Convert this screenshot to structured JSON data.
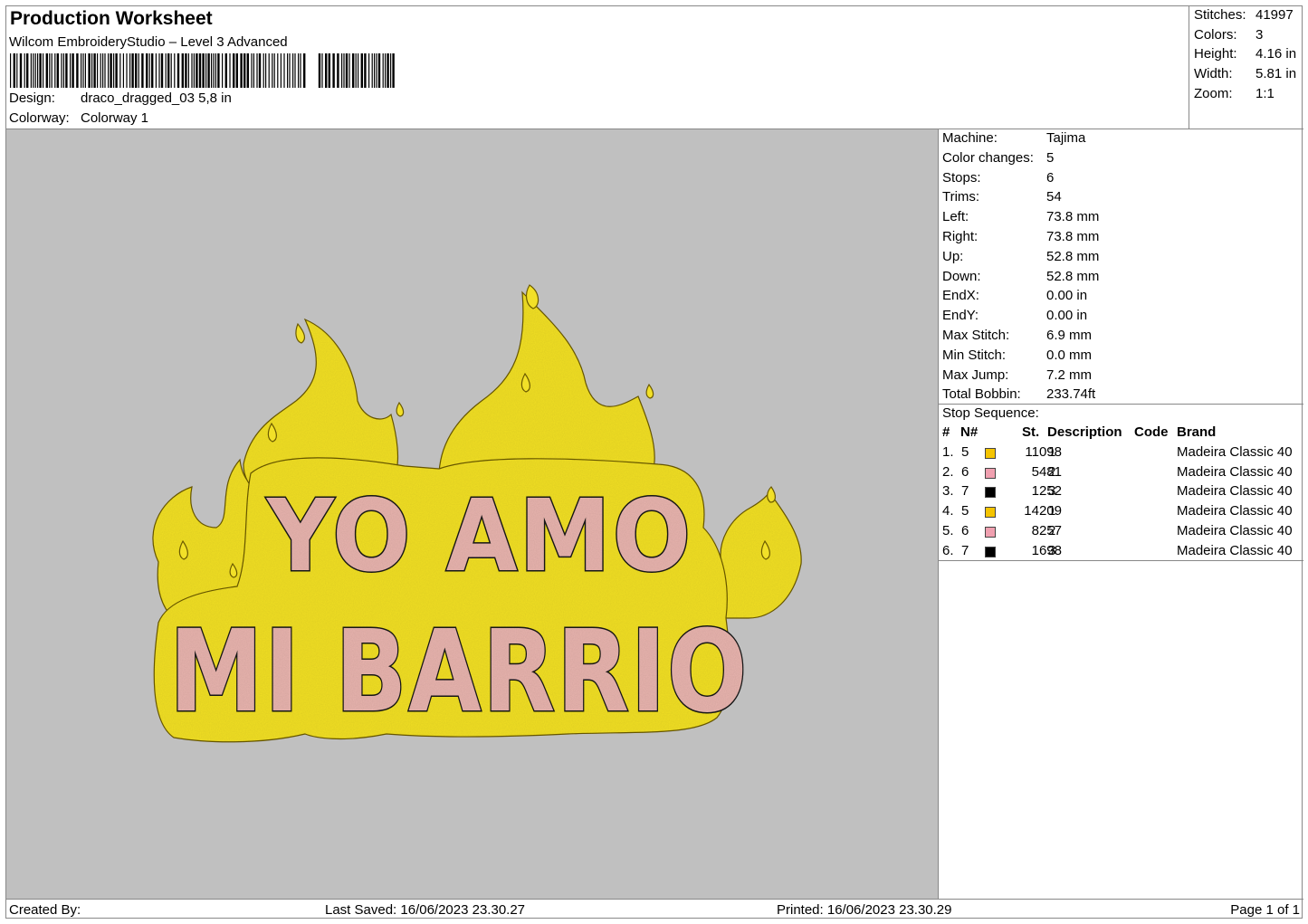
{
  "header": {
    "title": "Production Worksheet",
    "software": "Wilcom EmbroideryStudio – Level 3 Advanced",
    "design_label": "Design:",
    "design_value": "draco_dragged_03 5,8 in",
    "colorway_label": "Colorway:",
    "colorway_value": "Colorway 1"
  },
  "summary": {
    "stitches_label": "Stitches:",
    "stitches": "41997",
    "colors_label": "Colors:",
    "colors": "3",
    "height_label": "Height:",
    "height": "4.16 in",
    "width_label": "Width:",
    "width": "5.81 in",
    "zoom_label": "Zoom:",
    "zoom": "1:1"
  },
  "preview": {
    "line1": "YO AMO",
    "line2": "MI BARRIO",
    "colors": {
      "background": "#c0c0c0",
      "flame": "#f2e028",
      "letters": "#e8b4ae",
      "outline": "#1a1a1a"
    }
  },
  "machine_info": [
    {
      "label": "Machine:",
      "value": "Tajima"
    },
    {
      "label": "Color changes:",
      "value": "5"
    },
    {
      "label": "Stops:",
      "value": "6"
    },
    {
      "label": "Trims:",
      "value": "54"
    },
    {
      "label": "Left:",
      "value": "73.8 mm"
    },
    {
      "label": "Right:",
      "value": "73.8 mm"
    },
    {
      "label": "Up:",
      "value": "52.8 mm"
    },
    {
      "label": "Down:",
      "value": "52.8 mm"
    },
    {
      "label": "EndX:",
      "value": "0.00 in"
    },
    {
      "label": "EndY:",
      "value": "0.00 in"
    },
    {
      "label": "Max Stitch:",
      "value": "6.9 mm"
    },
    {
      "label": "Min Stitch:",
      "value": "0.0 mm"
    },
    {
      "label": "Max Jump:",
      "value": "7.2 mm"
    },
    {
      "label": "Total Bobbin:",
      "value": "233.74ft"
    }
  ],
  "stop_sequence": {
    "title": "Stop Sequence:",
    "columns": {
      "num": "#",
      "needle": "N#",
      "stitches": "St.",
      "description": "Description",
      "code": "Code",
      "brand": "Brand"
    },
    "rows": [
      {
        "num": "1.",
        "needle": "5",
        "color": "#f5c400",
        "stitches": "11098",
        "description": "1",
        "code": "",
        "brand": "Madeira Classic 40"
      },
      {
        "num": "2.",
        "needle": "6",
        "color": "#f0a0b0",
        "stitches": "5481",
        "description": "2",
        "code": "",
        "brand": "Madeira Classic 40"
      },
      {
        "num": "3.",
        "needle": "7",
        "color": "#000000",
        "stitches": "1252",
        "description": "3",
        "code": "",
        "brand": "Madeira Classic 40"
      },
      {
        "num": "4.",
        "needle": "5",
        "color": "#f5c400",
        "stitches": "14209",
        "description": "1",
        "code": "",
        "brand": "Madeira Classic 40"
      },
      {
        "num": "5.",
        "needle": "6",
        "color": "#f0a0b0",
        "stitches": "8257",
        "description": "2",
        "code": "",
        "brand": "Madeira Classic 40"
      },
      {
        "num": "6.",
        "needle": "7",
        "color": "#000000",
        "stitches": "1698",
        "description": "3",
        "code": "",
        "brand": "Madeira Classic 40"
      }
    ]
  },
  "footer": {
    "created_by": "Created By:",
    "last_saved": "Last Saved: 16/06/2023 23.30.27",
    "printed": "Printed: 16/06/2023 23.30.29",
    "page": "Page 1 of 1"
  }
}
